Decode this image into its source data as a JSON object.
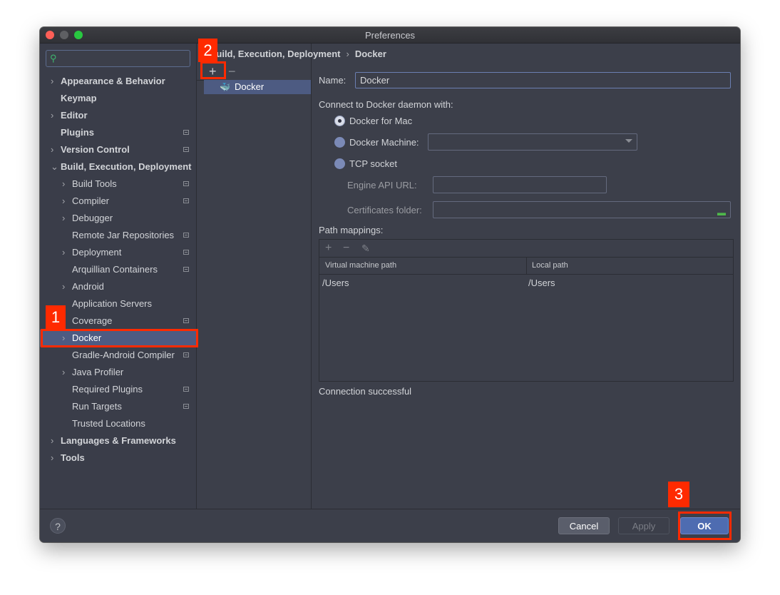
{
  "window": {
    "title": "Preferences"
  },
  "sidebar": {
    "search_placeholder": "",
    "items": [
      {
        "label": "Appearance & Behavior",
        "arrow": "›",
        "bold": true
      },
      {
        "label": "Keymap",
        "arrow": "",
        "bold": true
      },
      {
        "label": "Editor",
        "arrow": "›",
        "bold": true
      },
      {
        "label": "Plugins",
        "arrow": "",
        "bold": true
      },
      {
        "label": "Version Control",
        "arrow": "›",
        "bold": true
      },
      {
        "label": "Build, Execution, Deployment",
        "arrow": "⌄",
        "bold": true
      },
      {
        "label": "Build Tools",
        "arrow": "›",
        "bold": false
      },
      {
        "label": "Compiler",
        "arrow": "›",
        "bold": false
      },
      {
        "label": "Debugger",
        "arrow": "›",
        "bold": false
      },
      {
        "label": "Remote Jar Repositories",
        "arrow": "",
        "bold": false
      },
      {
        "label": "Deployment",
        "arrow": "›",
        "bold": false
      },
      {
        "label": "Arquillian Containers",
        "arrow": "",
        "bold": false
      },
      {
        "label": "Android",
        "arrow": "›",
        "bold": false
      },
      {
        "label": "Application Servers",
        "arrow": "",
        "bold": false
      },
      {
        "label": "Coverage",
        "arrow": "",
        "bold": false
      },
      {
        "label": "Docker",
        "arrow": "›",
        "bold": false
      },
      {
        "label": "Gradle-Android Compiler",
        "arrow": "",
        "bold": false
      },
      {
        "label": "Java Profiler",
        "arrow": "›",
        "bold": false
      },
      {
        "label": "Required Plugins",
        "arrow": "",
        "bold": false
      },
      {
        "label": "Run Targets",
        "arrow": "",
        "bold": false
      },
      {
        "label": "Trusted Locations",
        "arrow": "",
        "bold": false
      },
      {
        "label": "Languages & Frameworks",
        "arrow": "›",
        "bold": true
      },
      {
        "label": "Tools",
        "arrow": "›",
        "bold": true
      }
    ]
  },
  "breadcrumb": {
    "parent": "Build, Execution, Deployment",
    "separator": "›",
    "current": "Docker"
  },
  "middle": {
    "add": "+",
    "remove": "−",
    "docker_label": "Docker"
  },
  "form": {
    "name_label": "Name:",
    "name_value": "Docker",
    "connect_label": "Connect to Docker daemon with:",
    "radio_mac": "Docker for Mac",
    "radio_machine": "Docker Machine:",
    "radio_tcp": "TCP socket",
    "engine_label": "Engine API URL:",
    "engine_value": "",
    "cert_label": "Certificates folder:",
    "cert_value": "",
    "path_mappings_label": "Path mappings:",
    "table": {
      "add": "+",
      "remove": "−",
      "edit": "✎",
      "headers": [
        "Virtual machine path",
        "Local path"
      ],
      "rows": [
        [
          "/Users",
          "/Users"
        ]
      ]
    },
    "status": "Connection successful"
  },
  "buttons": {
    "help": "?",
    "cancel": "Cancel",
    "apply": "Apply",
    "ok": "OK"
  },
  "annotations": {
    "step1": "1",
    "step2": "2",
    "step3": "3"
  }
}
